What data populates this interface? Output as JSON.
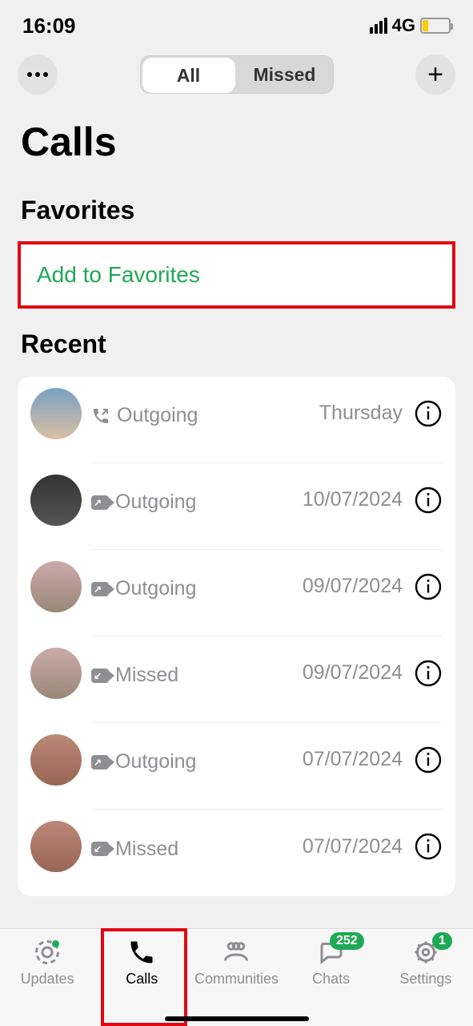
{
  "status": {
    "time": "16:09",
    "network": "4G"
  },
  "tabs": {
    "all": "All",
    "missed": "Missed"
  },
  "title": "Calls",
  "sections": {
    "favorites": "Favorites",
    "recent": "Recent"
  },
  "favorites": {
    "add": "Add to Favorites"
  },
  "calls": [
    {
      "type": "Outgoing",
      "date": "Thursday",
      "kind": "phone",
      "dir": "out"
    },
    {
      "type": "Outgoing",
      "date": "10/07/2024",
      "kind": "video",
      "dir": "out"
    },
    {
      "type": "Outgoing",
      "date": "09/07/2024",
      "kind": "video",
      "dir": "out"
    },
    {
      "type": "Missed",
      "date": "09/07/2024",
      "kind": "video",
      "dir": "in"
    },
    {
      "type": "Outgoing",
      "date": "07/07/2024",
      "kind": "video",
      "dir": "out"
    },
    {
      "type": "Missed",
      "date": "07/07/2024",
      "kind": "video",
      "dir": "in"
    }
  ],
  "nav": {
    "updates": "Updates",
    "calls": "Calls",
    "communities": "Communities",
    "chats": "Chats",
    "settings": "Settings",
    "chats_badge": "252",
    "settings_badge": "1"
  }
}
